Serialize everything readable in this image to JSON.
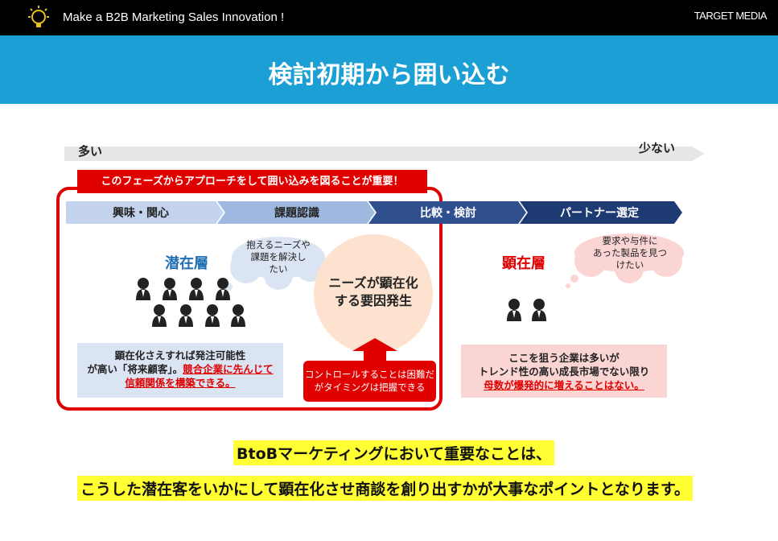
{
  "header": {
    "tagline": "Make a B2B Marketing Sales Innovation !",
    "logo": "TARGET MEDIA",
    "icon": "lightbulb-icon"
  },
  "title": "検討初期から囲い込む",
  "scale": {
    "left_label": "多い",
    "right_label": "少ない"
  },
  "banner": "このフェーズからアプローチをして囲い込みを図ることが重要！",
  "phases": [
    "興味・関心",
    "課題認識",
    "比較・検討",
    "パートナー選定"
  ],
  "latent": {
    "title": "潜在層",
    "thought": [
      "抱えるニーズや",
      "課題を解決し",
      "たい"
    ],
    "note_black": [
      "顕在化さえすれば発注可能性",
      "が高い「将来顧客」。"
    ],
    "note_red_1": "競合企業に先んじて",
    "note_red_2": "信頼関係を構築できる。"
  },
  "trigger": {
    "circle": [
      "ニーズが顕在化",
      "する要因発生"
    ],
    "callout": [
      "コントロールすることは困難だ",
      "がタイミングは把握できる"
    ]
  },
  "manifest": {
    "title": "顕在層",
    "thought": [
      "要求や与件に",
      "あった製品を見つ",
      "けたい"
    ],
    "note_black": [
      "ここを狙う企業は多いが",
      "トレンド性の高い成長市場でない限り"
    ],
    "note_red": "母数が爆発的に増えることはない。"
  },
  "conclusion": {
    "line1": "BtoBマーケティングにおいて重要なことは、",
    "line2": "こうした潜在客をいかにして顕在化させ商談を創り出すかが大事なポイントとなります。"
  },
  "colors": {
    "title_bar": "#1c9fd5",
    "red": "#e00000",
    "latent_blue": "#1f6fb2",
    "phase_light": "#9fb8e0",
    "phase_dark": "#2f4f8f",
    "highlight": "#ffff33"
  }
}
